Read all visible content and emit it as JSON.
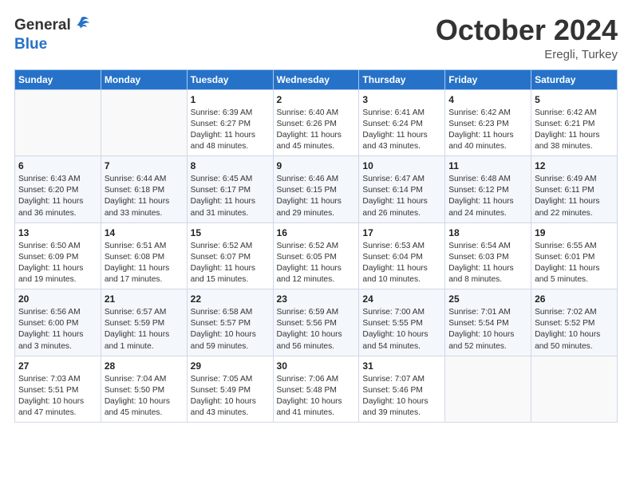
{
  "header": {
    "logo_general": "General",
    "logo_blue": "Blue",
    "month_title": "October 2024",
    "subtitle": "Eregli, Turkey"
  },
  "days_of_week": [
    "Sunday",
    "Monday",
    "Tuesday",
    "Wednesday",
    "Thursday",
    "Friday",
    "Saturday"
  ],
  "weeks": [
    [
      {
        "day": "",
        "sunrise": "",
        "sunset": "",
        "daylight": ""
      },
      {
        "day": "",
        "sunrise": "",
        "sunset": "",
        "daylight": ""
      },
      {
        "day": "1",
        "sunrise": "Sunrise: 6:39 AM",
        "sunset": "Sunset: 6:27 PM",
        "daylight": "Daylight: 11 hours and 48 minutes."
      },
      {
        "day": "2",
        "sunrise": "Sunrise: 6:40 AM",
        "sunset": "Sunset: 6:26 PM",
        "daylight": "Daylight: 11 hours and 45 minutes."
      },
      {
        "day": "3",
        "sunrise": "Sunrise: 6:41 AM",
        "sunset": "Sunset: 6:24 PM",
        "daylight": "Daylight: 11 hours and 43 minutes."
      },
      {
        "day": "4",
        "sunrise": "Sunrise: 6:42 AM",
        "sunset": "Sunset: 6:23 PM",
        "daylight": "Daylight: 11 hours and 40 minutes."
      },
      {
        "day": "5",
        "sunrise": "Sunrise: 6:42 AM",
        "sunset": "Sunset: 6:21 PM",
        "daylight": "Daylight: 11 hours and 38 minutes."
      }
    ],
    [
      {
        "day": "6",
        "sunrise": "Sunrise: 6:43 AM",
        "sunset": "Sunset: 6:20 PM",
        "daylight": "Daylight: 11 hours and 36 minutes."
      },
      {
        "day": "7",
        "sunrise": "Sunrise: 6:44 AM",
        "sunset": "Sunset: 6:18 PM",
        "daylight": "Daylight: 11 hours and 33 minutes."
      },
      {
        "day": "8",
        "sunrise": "Sunrise: 6:45 AM",
        "sunset": "Sunset: 6:17 PM",
        "daylight": "Daylight: 11 hours and 31 minutes."
      },
      {
        "day": "9",
        "sunrise": "Sunrise: 6:46 AM",
        "sunset": "Sunset: 6:15 PM",
        "daylight": "Daylight: 11 hours and 29 minutes."
      },
      {
        "day": "10",
        "sunrise": "Sunrise: 6:47 AM",
        "sunset": "Sunset: 6:14 PM",
        "daylight": "Daylight: 11 hours and 26 minutes."
      },
      {
        "day": "11",
        "sunrise": "Sunrise: 6:48 AM",
        "sunset": "Sunset: 6:12 PM",
        "daylight": "Daylight: 11 hours and 24 minutes."
      },
      {
        "day": "12",
        "sunrise": "Sunrise: 6:49 AM",
        "sunset": "Sunset: 6:11 PM",
        "daylight": "Daylight: 11 hours and 22 minutes."
      }
    ],
    [
      {
        "day": "13",
        "sunrise": "Sunrise: 6:50 AM",
        "sunset": "Sunset: 6:09 PM",
        "daylight": "Daylight: 11 hours and 19 minutes."
      },
      {
        "day": "14",
        "sunrise": "Sunrise: 6:51 AM",
        "sunset": "Sunset: 6:08 PM",
        "daylight": "Daylight: 11 hours and 17 minutes."
      },
      {
        "day": "15",
        "sunrise": "Sunrise: 6:52 AM",
        "sunset": "Sunset: 6:07 PM",
        "daylight": "Daylight: 11 hours and 15 minutes."
      },
      {
        "day": "16",
        "sunrise": "Sunrise: 6:52 AM",
        "sunset": "Sunset: 6:05 PM",
        "daylight": "Daylight: 11 hours and 12 minutes."
      },
      {
        "day": "17",
        "sunrise": "Sunrise: 6:53 AM",
        "sunset": "Sunset: 6:04 PM",
        "daylight": "Daylight: 11 hours and 10 minutes."
      },
      {
        "day": "18",
        "sunrise": "Sunrise: 6:54 AM",
        "sunset": "Sunset: 6:03 PM",
        "daylight": "Daylight: 11 hours and 8 minutes."
      },
      {
        "day": "19",
        "sunrise": "Sunrise: 6:55 AM",
        "sunset": "Sunset: 6:01 PM",
        "daylight": "Daylight: 11 hours and 5 minutes."
      }
    ],
    [
      {
        "day": "20",
        "sunrise": "Sunrise: 6:56 AM",
        "sunset": "Sunset: 6:00 PM",
        "daylight": "Daylight: 11 hours and 3 minutes."
      },
      {
        "day": "21",
        "sunrise": "Sunrise: 6:57 AM",
        "sunset": "Sunset: 5:59 PM",
        "daylight": "Daylight: 11 hours and 1 minute."
      },
      {
        "day": "22",
        "sunrise": "Sunrise: 6:58 AM",
        "sunset": "Sunset: 5:57 PM",
        "daylight": "Daylight: 10 hours and 59 minutes."
      },
      {
        "day": "23",
        "sunrise": "Sunrise: 6:59 AM",
        "sunset": "Sunset: 5:56 PM",
        "daylight": "Daylight: 10 hours and 56 minutes."
      },
      {
        "day": "24",
        "sunrise": "Sunrise: 7:00 AM",
        "sunset": "Sunset: 5:55 PM",
        "daylight": "Daylight: 10 hours and 54 minutes."
      },
      {
        "day": "25",
        "sunrise": "Sunrise: 7:01 AM",
        "sunset": "Sunset: 5:54 PM",
        "daylight": "Daylight: 10 hours and 52 minutes."
      },
      {
        "day": "26",
        "sunrise": "Sunrise: 7:02 AM",
        "sunset": "Sunset: 5:52 PM",
        "daylight": "Daylight: 10 hours and 50 minutes."
      }
    ],
    [
      {
        "day": "27",
        "sunrise": "Sunrise: 7:03 AM",
        "sunset": "Sunset: 5:51 PM",
        "daylight": "Daylight: 10 hours and 47 minutes."
      },
      {
        "day": "28",
        "sunrise": "Sunrise: 7:04 AM",
        "sunset": "Sunset: 5:50 PM",
        "daylight": "Daylight: 10 hours and 45 minutes."
      },
      {
        "day": "29",
        "sunrise": "Sunrise: 7:05 AM",
        "sunset": "Sunset: 5:49 PM",
        "daylight": "Daylight: 10 hours and 43 minutes."
      },
      {
        "day": "30",
        "sunrise": "Sunrise: 7:06 AM",
        "sunset": "Sunset: 5:48 PM",
        "daylight": "Daylight: 10 hours and 41 minutes."
      },
      {
        "day": "31",
        "sunrise": "Sunrise: 7:07 AM",
        "sunset": "Sunset: 5:46 PM",
        "daylight": "Daylight: 10 hours and 39 minutes."
      },
      {
        "day": "",
        "sunrise": "",
        "sunset": "",
        "daylight": ""
      },
      {
        "day": "",
        "sunrise": "",
        "sunset": "",
        "daylight": ""
      }
    ]
  ]
}
